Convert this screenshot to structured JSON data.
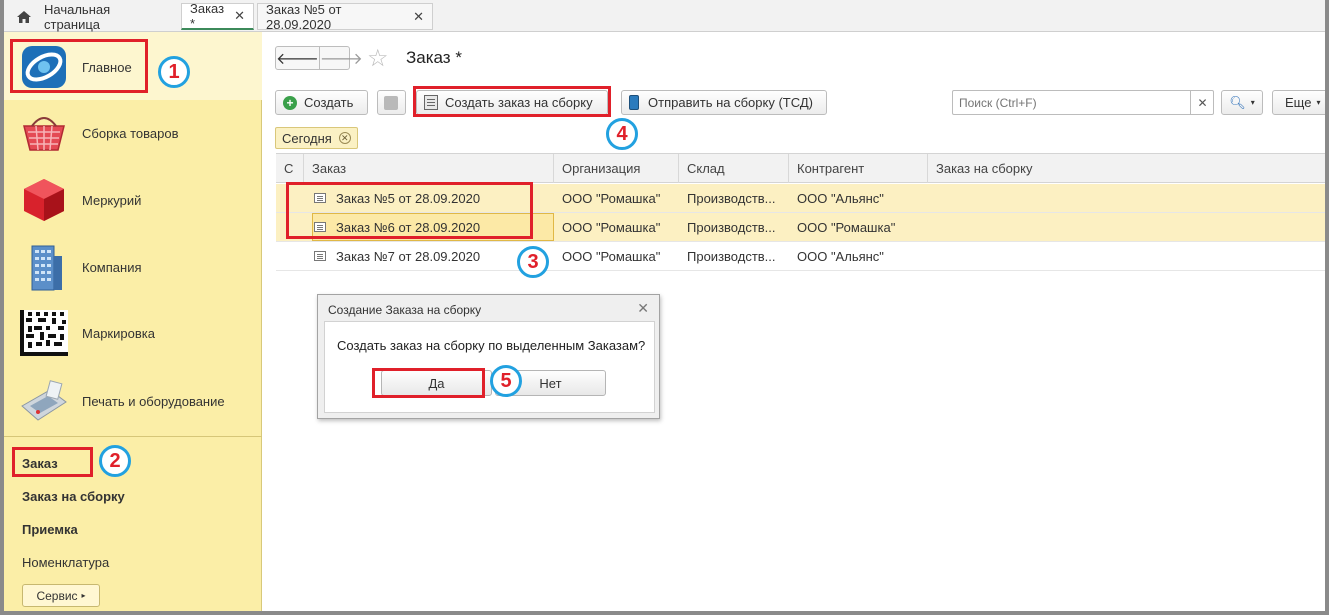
{
  "tabs": [
    {
      "label": "Начальная страница"
    },
    {
      "label": "Заказ *"
    },
    {
      "label": "Заказ №5 от 28.09.2020"
    }
  ],
  "sidebar": {
    "sections": [
      {
        "label": "Главное",
        "icon": "main-logo-icon"
      },
      {
        "label": "Сборка товаров",
        "icon": "basket-icon"
      },
      {
        "label": "Меркурий",
        "icon": "red-cube-icon"
      },
      {
        "label": "Компания",
        "icon": "building-icon"
      },
      {
        "label": "Маркировка",
        "icon": "datamatrix-icon"
      },
      {
        "label": "Печать и оборудование",
        "icon": "card-terminal-icon"
      }
    ],
    "links": [
      {
        "label": "Заказ"
      },
      {
        "label": "Заказ на сборку"
      },
      {
        "label": "Приемка"
      },
      {
        "label": "Номенклатура"
      }
    ],
    "service_label": "Сервис"
  },
  "form": {
    "title": "Заказ *",
    "create_label": "Создать",
    "create_assembly_label": "Создать заказ на сборку",
    "send_tsd_label": "Отправить на сборку (ТСД)",
    "search_placeholder": "Поиск (Ctrl+F)",
    "more_label": "Еще",
    "filter_chip": "Сегодня"
  },
  "table": {
    "columns": [
      "С",
      "Заказ",
      "Организация",
      "Склад",
      "Контрагент",
      "Заказ на сборку"
    ],
    "rows": [
      {
        "order": "Заказ №5 от 28.09.2020",
        "org": "ООО \"Ромашка\"",
        "warehouse": "Производств...",
        "counterparty": "ООО \"Альянс\"",
        "assembly": "",
        "selected": true
      },
      {
        "order": "Заказ №6 от 28.09.2020",
        "org": "ООО \"Ромашка\"",
        "warehouse": "Производств...",
        "counterparty": "ООО \"Ромашка\"",
        "assembly": "",
        "selected": true
      },
      {
        "order": "Заказ №7 от 28.09.2020",
        "org": "ООО \"Ромашка\"",
        "warehouse": "Производств...",
        "counterparty": "ООО \"Альянс\"",
        "assembly": "",
        "selected": false
      }
    ]
  },
  "dialog": {
    "title": "Создание Заказа на сборку",
    "message": "Создать заказ на сборку по выделенным Заказам?",
    "yes_label": "Да",
    "no_label": "Нет"
  },
  "annotations": [
    "1",
    "2",
    "3",
    "4",
    "5"
  ],
  "colors": {
    "sidebar_bg": "#fbeea7",
    "selected_row": "#fcf0c2",
    "annotation_red": "#e0202a",
    "annotation_blue": "#22a1e0"
  }
}
